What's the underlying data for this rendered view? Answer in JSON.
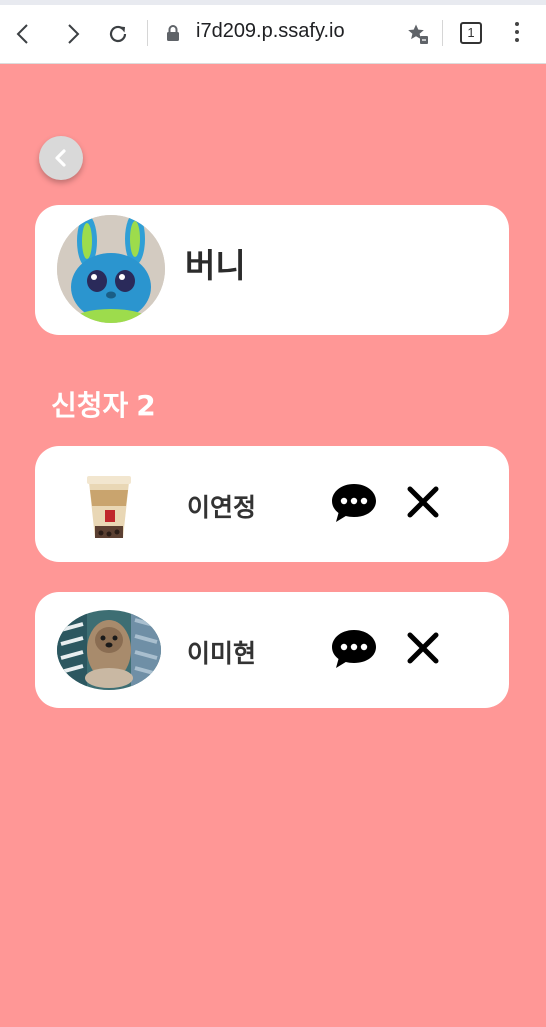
{
  "browser": {
    "url": "i7d209.p.ssafy.io",
    "tab_count": "1",
    "icons": [
      "back-icon",
      "forward-icon",
      "reload-icon",
      "lock-icon",
      "bookmark-star-icon",
      "tab-count-icon",
      "more-vert-icon"
    ]
  },
  "page": {
    "background_color": "#ff9796",
    "back_icon": "chevron-left-icon",
    "owner": {
      "name": "버니",
      "avatar_icon": "bunny-plush-photo"
    },
    "applicants_section": {
      "label": "신청자",
      "count": "2"
    },
    "applicants": [
      {
        "name": "이연정",
        "avatar_icon": "bubble-tea-photo",
        "chat_icon": "chat-bubble-icon",
        "remove_icon": "close-icon"
      },
      {
        "name": "이미현",
        "avatar_icon": "dog-photo",
        "chat_icon": "chat-bubble-icon",
        "remove_icon": "close-icon"
      }
    ]
  }
}
